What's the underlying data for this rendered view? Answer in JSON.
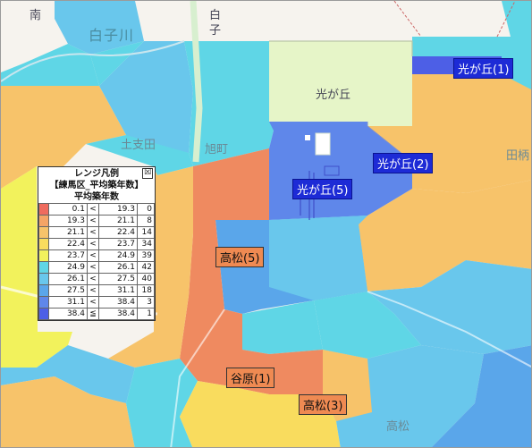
{
  "map": {
    "labels": {
      "minami": "南",
      "shirako_town": "白",
      "shirako_town_2": "子",
      "shirako_river": "白子川",
      "hikarigaoka": "光が丘",
      "tsuchishida": "土支田",
      "asahimachi": "旭町",
      "tagara": "田柄",
      "takamatsu": "高松",
      "ninohe": "谷原"
    },
    "areas": {
      "hikarigaoka_1": "光が丘(1)",
      "hikarigaoka_2": "光が丘(2)",
      "hikarigaoka_5": "光が丘(5)",
      "takamatsu_5": "高松(5)",
      "yawara_1": "谷原(1)",
      "takamatsu_3": "高松(3)"
    },
    "colors": {
      "c1": "#ef6b5e",
      "c2": "#f5a466",
      "c3": "#f7c36a",
      "c4": "#f9dc5e",
      "c5": "#f2f25c",
      "c6": "#5fd6e6",
      "c7": "#69c7ec",
      "c8": "#5aa6ea",
      "c9": "#5f87ea",
      "c10": "#4d5fe6",
      "park": "#e6f5c8",
      "road": "#f6f3ee"
    }
  },
  "legend": {
    "title": "レンジ凡例",
    "subtitle": "【練馬区_平均築年数】",
    "field": "平均築年数",
    "close_symbol": "☒",
    "rows": [
      {
        "color": "#ef6b5e",
        "low": "0.1",
        "op": "<",
        "high": "19.3",
        "count": "0"
      },
      {
        "color": "#f5a466",
        "low": "19.3",
        "op": "<",
        "high": "21.1",
        "count": "8"
      },
      {
        "color": "#f7c36a",
        "low": "21.1",
        "op": "<",
        "high": "22.4",
        "count": "14"
      },
      {
        "color": "#f9dc5e",
        "low": "22.4",
        "op": "<",
        "high": "23.7",
        "count": "34"
      },
      {
        "color": "#f2f25c",
        "low": "23.7",
        "op": "<",
        "high": "24.9",
        "count": "39"
      },
      {
        "color": "#5fd6e6",
        "low": "24.9",
        "op": "<",
        "high": "26.1",
        "count": "42"
      },
      {
        "color": "#69c7ec",
        "low": "26.1",
        "op": "<",
        "high": "27.5",
        "count": "40"
      },
      {
        "color": "#5aa6ea",
        "low": "27.5",
        "op": "<",
        "high": "31.1",
        "count": "18"
      },
      {
        "color": "#5f87ea",
        "low": "31.1",
        "op": "<",
        "high": "38.4",
        "count": "3"
      },
      {
        "color": "#4d5fe6",
        "low": "38.4",
        "op": "≦",
        "high": "38.4",
        "count": "1"
      }
    ]
  }
}
